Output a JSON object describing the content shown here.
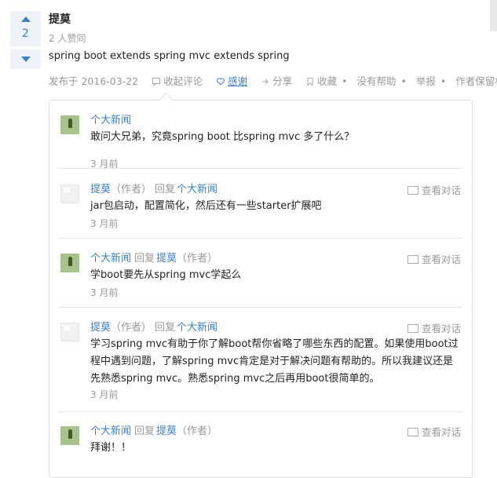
{
  "answer": {
    "votes": "2",
    "author": "提莫",
    "agree_text": "2 人赞同",
    "body": "spring boot extends spring mvc extends spring",
    "meta": {
      "published": "发布于 2016-03-22",
      "collapse": "收起评论",
      "thanks": "感谢",
      "share": "分享",
      "collect": "收藏",
      "no_help": "没有帮助",
      "report": "举报",
      "copyright": "作者保留权利"
    }
  },
  "comments": [
    {
      "author": "个大新闻",
      "author_role": "",
      "reply_word": "",
      "reply_to": "",
      "reply_to_role": "",
      "text": "敢问大兄弟，究竟spring boot 比spring mvc 多了什么？",
      "time": "3 月前",
      "view": ""
    },
    {
      "author": "提莫",
      "author_role": "（作者）",
      "reply_word": "回复",
      "reply_to": "个大新闻",
      "reply_to_role": "",
      "text": "jar包启动，配置简化，然后还有一些starter扩展吧",
      "time": "3 月前",
      "view": "查看对话"
    },
    {
      "author": "个大新闻",
      "author_role": "",
      "reply_word": "回复",
      "reply_to": "提莫",
      "reply_to_role": "（作者）",
      "text": "学boot要先从spring mvc学起么",
      "time": "3 月前",
      "view": "查看对话"
    },
    {
      "author": "提莫",
      "author_role": "（作者）",
      "reply_word": "回复",
      "reply_to": "个大新闻",
      "reply_to_role": "",
      "text": "学习spring mvc有助于你了解boot帮你省略了哪些东西的配置。如果使用boot过程中遇到问题，了解spring mvc肯定是对于解决问题有帮助的。所以我建议还是先熟悉spring mvc。熟悉spring mvc之后再用boot很简单的。",
      "time": "3 月前",
      "view": "查看对话"
    },
    {
      "author": "个大新闻",
      "author_role": "",
      "reply_word": "回复",
      "reply_to": "提莫",
      "reply_to_role": "（作者）",
      "text": "拜谢！！",
      "time": "",
      "view": "查看对话"
    }
  ],
  "icons": {
    "vote_up": "triangle-up-icon",
    "vote_down": "triangle-down-icon",
    "collapse": "comment-icon",
    "thanks": "heart-icon",
    "share": "share-arrow-icon",
    "collect": "bookmark-icon",
    "view": "dialog-icon"
  },
  "colors": {
    "link": "#3b7fc4",
    "muted": "#999999",
    "vote_bg": "#eef3f9"
  }
}
